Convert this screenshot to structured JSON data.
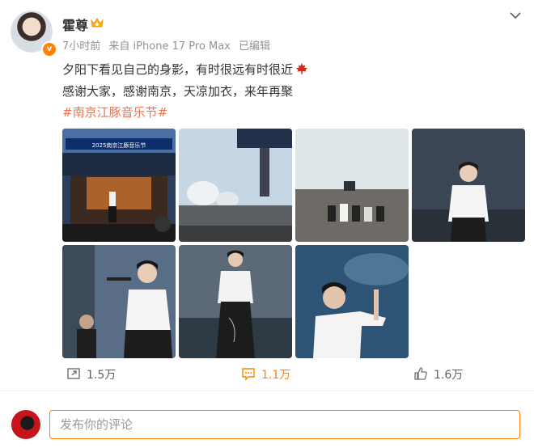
{
  "post": {
    "author": {
      "name": "霍尊",
      "avatar_icon": "avatar-image",
      "verified_icon": "verified-badge-icon",
      "badge_icon": "crown-icon"
    },
    "meta": {
      "time": "7小时前",
      "source": "来自 iPhone 17 Pro Max",
      "edited": "已编辑"
    },
    "content": {
      "line1": "夕阳下看见自己的身影，有时很远有时很近",
      "line2": "感谢大家，感谢南京，天凉加衣，来年再聚",
      "hashtag": "#南京江豚音乐节#",
      "emoji_icon": "maple-leaf-icon"
    },
    "photos": [
      {
        "name": "stage-banner-photo",
        "banner_text": "2025南京江豚音乐节"
      },
      {
        "name": "stage-sky-photo"
      },
      {
        "name": "crowd-group-photo"
      },
      {
        "name": "white-shirt-portrait-photo"
      },
      {
        "name": "singing-with-guitarist-photo"
      },
      {
        "name": "singing-full-body-photo"
      },
      {
        "name": "raised-hand-photo"
      }
    ]
  },
  "actions": {
    "repost_count": "1.5万",
    "comment_count": "1.1万",
    "like_count": "1.6万"
  },
  "comment_input": {
    "placeholder": "发布你的评论"
  },
  "colors": {
    "accent": "#ff8200",
    "hashtag": "#eb7350",
    "muted": "#939393"
  }
}
